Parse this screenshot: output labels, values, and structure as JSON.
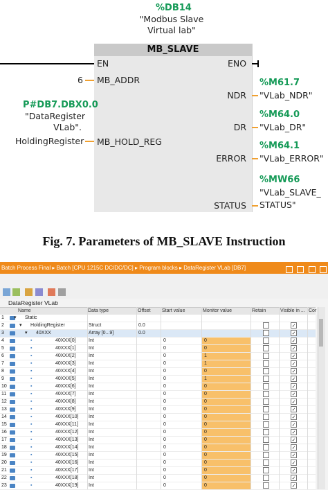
{
  "diagram": {
    "db_address": "%DB14",
    "db_comment_1": "\"Modbus Slave",
    "db_comment_2": "Virtual lab\"",
    "block_title": "MB_SLAVE",
    "pin_en": "EN",
    "pin_eno": "ENO",
    "pin_mb_addr": "MB_ADDR",
    "mb_addr_value": "6",
    "pin_ndr": "NDR",
    "ndr_address": "%M61.7",
    "ndr_tag": "\"VLab_NDR\"",
    "pin_dr": "DR",
    "dr_address": "%M64.0",
    "dr_tag": "\"VLab_DR\"",
    "pin_error": "ERROR",
    "error_address": "%M64.1",
    "error_tag": "\"VLab_ERROR\"",
    "pin_status": "STATUS",
    "status_address": "%MW66",
    "status_tag_1": "\"VLab_SLAVE_",
    "status_tag_2": "STATUS\"",
    "pin_hold_reg": "MB_HOLD_REG",
    "hold_reg_address": "P#DB7.DBX0.0",
    "hold_reg_1": "\"DataRegister",
    "hold_reg_2": "VLab\".",
    "hold_reg_3": "HoldingRegister"
  },
  "caption": "Fig. 7. Parameters of MB_SLAVE Instruction",
  "window": {
    "breadcrumb": "Batch Process Final  ▸  Batch [CPU 1215C DC/DC/DC]  ▸  Program blocks  ▸  DataRegister VLab [DB7]",
    "db_name": "DataRegister VLab",
    "columns": [
      "Name",
      "Data type",
      "Offset",
      "Start value",
      "Monitor value",
      "Retain",
      "Visible in ...",
      "Cor"
    ],
    "rows": [
      {
        "num": "1",
        "name": "Static",
        "type": "",
        "offset": "",
        "start": "",
        "monitor": "",
        "indent": 0,
        "expander": "▾",
        "monitored": false,
        "retain": false,
        "visible": false
      },
      {
        "num": "2",
        "name": "HoldingRegister",
        "type": "Struct",
        "offset": "0.0",
        "start": "",
        "monitor": "",
        "indent": 1,
        "expander": "▾",
        "monitored": false,
        "retain": true,
        "visible": true
      },
      {
        "num": "3",
        "name": "40XXX",
        "type": "Array [0...9]",
        "offset": "0.0",
        "start": "",
        "monitor": "",
        "indent": 2,
        "expander": "▾",
        "monitored": false,
        "retain": false,
        "visible": true
      },
      {
        "num": "4",
        "name": "40XXX[0]",
        "type": "Int",
        "offset": "",
        "start": "0",
        "monitor": "0",
        "indent": 3,
        "expander": "",
        "monitored": true,
        "retain": false,
        "visible": true
      },
      {
        "num": "5",
        "name": "40XXX[1]",
        "type": "Int",
        "offset": "",
        "start": "0",
        "monitor": "0",
        "indent": 3,
        "expander": "",
        "monitored": true,
        "retain": false,
        "visible": true
      },
      {
        "num": "6",
        "name": "40XXX[2]",
        "type": "Int",
        "offset": "",
        "start": "0",
        "monitor": "1",
        "indent": 3,
        "expander": "",
        "monitored": true,
        "retain": false,
        "visible": true
      },
      {
        "num": "7",
        "name": "40XXX[3]",
        "type": "Int",
        "offset": "",
        "start": "0",
        "monitor": "1",
        "indent": 3,
        "expander": "",
        "monitored": true,
        "retain": false,
        "visible": true
      },
      {
        "num": "8",
        "name": "40XXX[4]",
        "type": "Int",
        "offset": "",
        "start": "0",
        "monitor": "0",
        "indent": 3,
        "expander": "",
        "monitored": true,
        "retain": false,
        "visible": true
      },
      {
        "num": "9",
        "name": "40XXX[5]",
        "type": "Int",
        "offset": "",
        "start": "0",
        "monitor": "1",
        "indent": 3,
        "expander": "",
        "monitored": true,
        "retain": false,
        "visible": true
      },
      {
        "num": "10",
        "name": "40XXX[6]",
        "type": "Int",
        "offset": "",
        "start": "0",
        "monitor": "0",
        "indent": 3,
        "expander": "",
        "monitored": true,
        "retain": false,
        "visible": true
      },
      {
        "num": "11",
        "name": "40XXX[7]",
        "type": "Int",
        "offset": "",
        "start": "0",
        "monitor": "0",
        "indent": 3,
        "expander": "",
        "monitored": true,
        "retain": false,
        "visible": true
      },
      {
        "num": "12",
        "name": "40XXX[8]",
        "type": "Int",
        "offset": "",
        "start": "0",
        "monitor": "0",
        "indent": 3,
        "expander": "",
        "monitored": true,
        "retain": false,
        "visible": true
      },
      {
        "num": "13",
        "name": "40XXX[9]",
        "type": "Int",
        "offset": "",
        "start": "0",
        "monitor": "0",
        "indent": 3,
        "expander": "",
        "monitored": true,
        "retain": false,
        "visible": true
      },
      {
        "num": "14",
        "name": "40XXX[10]",
        "type": "Int",
        "offset": "",
        "start": "0",
        "monitor": "0",
        "indent": 3,
        "expander": "",
        "monitored": true,
        "retain": false,
        "visible": true
      },
      {
        "num": "15",
        "name": "40XXX[11]",
        "type": "Int",
        "offset": "",
        "start": "0",
        "monitor": "0",
        "indent": 3,
        "expander": "",
        "monitored": true,
        "retain": false,
        "visible": true
      },
      {
        "num": "16",
        "name": "40XXX[12]",
        "type": "Int",
        "offset": "",
        "start": "0",
        "monitor": "0",
        "indent": 3,
        "expander": "",
        "monitored": true,
        "retain": false,
        "visible": true
      },
      {
        "num": "17",
        "name": "40XXX[13]",
        "type": "Int",
        "offset": "",
        "start": "0",
        "monitor": "0",
        "indent": 3,
        "expander": "",
        "monitored": true,
        "retain": false,
        "visible": true
      },
      {
        "num": "18",
        "name": "40XXX[14]",
        "type": "Int",
        "offset": "",
        "start": "0",
        "monitor": "0",
        "indent": 3,
        "expander": "",
        "monitored": true,
        "retain": false,
        "visible": true
      },
      {
        "num": "19",
        "name": "40XXX[15]",
        "type": "Int",
        "offset": "",
        "start": "0",
        "monitor": "0",
        "indent": 3,
        "expander": "",
        "monitored": true,
        "retain": false,
        "visible": true
      },
      {
        "num": "20",
        "name": "40XXX[16]",
        "type": "Int",
        "offset": "",
        "start": "0",
        "monitor": "0",
        "indent": 3,
        "expander": "",
        "monitored": true,
        "retain": false,
        "visible": true
      },
      {
        "num": "21",
        "name": "40XXX[17]",
        "type": "Int",
        "offset": "",
        "start": "0",
        "monitor": "0",
        "indent": 3,
        "expander": "",
        "monitored": true,
        "retain": false,
        "visible": true
      },
      {
        "num": "22",
        "name": "40XXX[18]",
        "type": "Int",
        "offset": "",
        "start": "0",
        "monitor": "0",
        "indent": 3,
        "expander": "",
        "monitored": true,
        "retain": false,
        "visible": true
      },
      {
        "num": "23",
        "name": "40XXX[19]",
        "type": "Int",
        "offset": "",
        "start": "0",
        "monitor": "0",
        "indent": 3,
        "expander": "",
        "monitored": true,
        "retain": false,
        "visible": true
      }
    ]
  },
  "colors": {
    "titlebar": "#ef8a1a",
    "monitor_highlight": "#f8c06a",
    "address_green": "#159a57",
    "wire_orange": "#f0a030"
  }
}
